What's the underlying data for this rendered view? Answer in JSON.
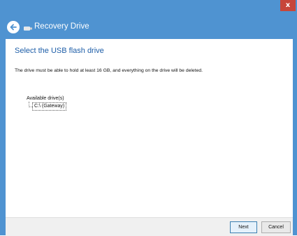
{
  "window": {
    "title": "Recovery Drive",
    "close_label": "x",
    "accent_color": "#4f93d1"
  },
  "icons": {
    "back": "back-arrow-icon",
    "drive": "usb-drive-icon"
  },
  "main": {
    "heading": "Select the USB flash drive",
    "description": "The drive must be able to hold at least 16 GB, and everything on the drive will be deleted.",
    "drives_label": "Available drive(s)",
    "drives": [
      {
        "label": "C:\\ (Gateway)"
      }
    ]
  },
  "footer": {
    "next_label": "Next",
    "cancel_label": "Cancel"
  }
}
